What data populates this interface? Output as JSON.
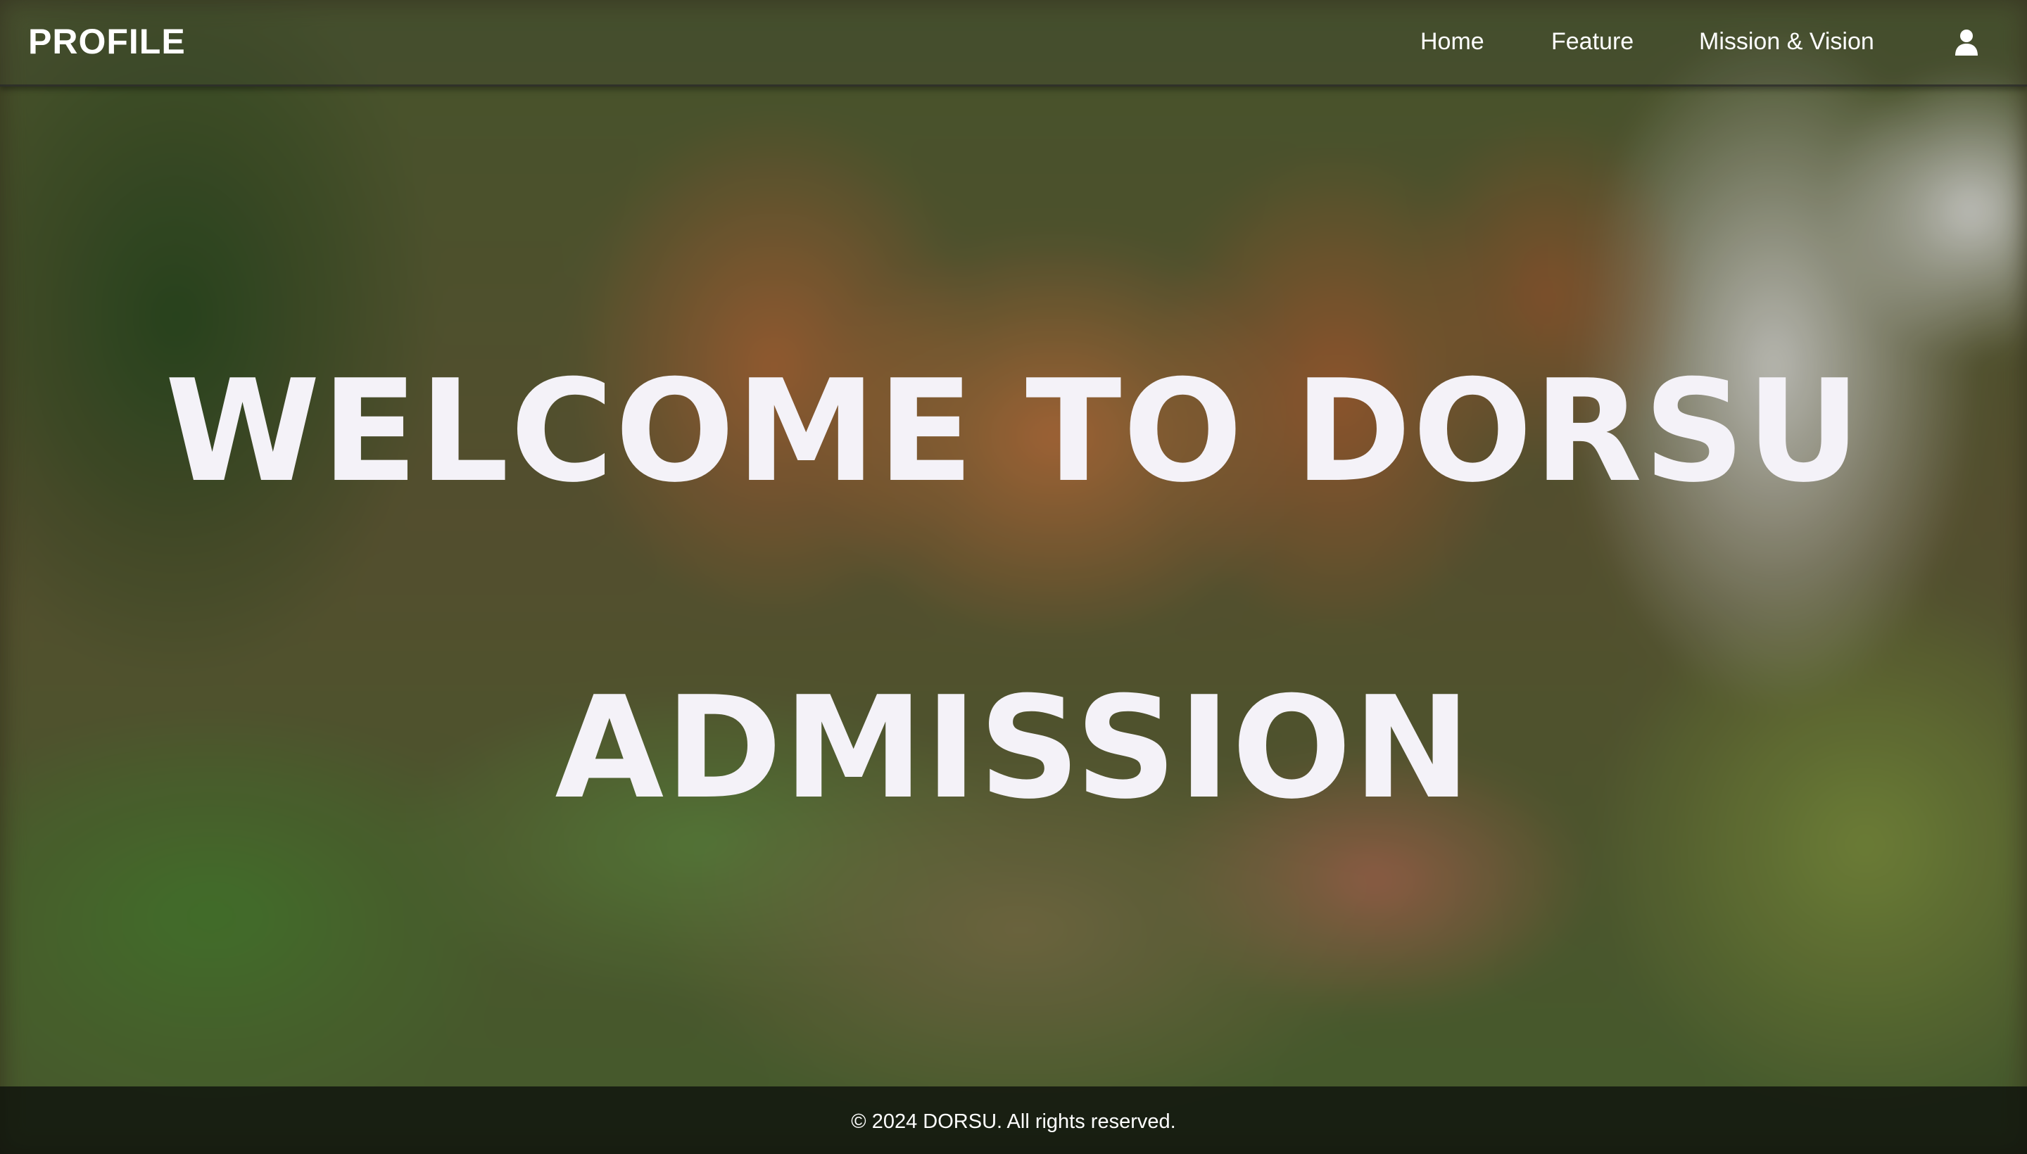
{
  "navbar": {
    "brand": "PROFILE",
    "links": [
      {
        "label": "Home"
      },
      {
        "label": "Feature"
      },
      {
        "label": "Mission & Vision"
      }
    ],
    "user_icon": "user-icon"
  },
  "hero": {
    "title_line_1": "WELCOME TO DORSU",
    "title_line_2": "ADMISSION",
    "background": "blurred photo of brown statue group with green foliage"
  },
  "footer": {
    "text": "© 2024 DORSU. All rights reserved."
  },
  "colors": {
    "hero_text": "#f4f2f8",
    "nav_text": "#ffffff",
    "footer_bg": "#0f120c"
  }
}
